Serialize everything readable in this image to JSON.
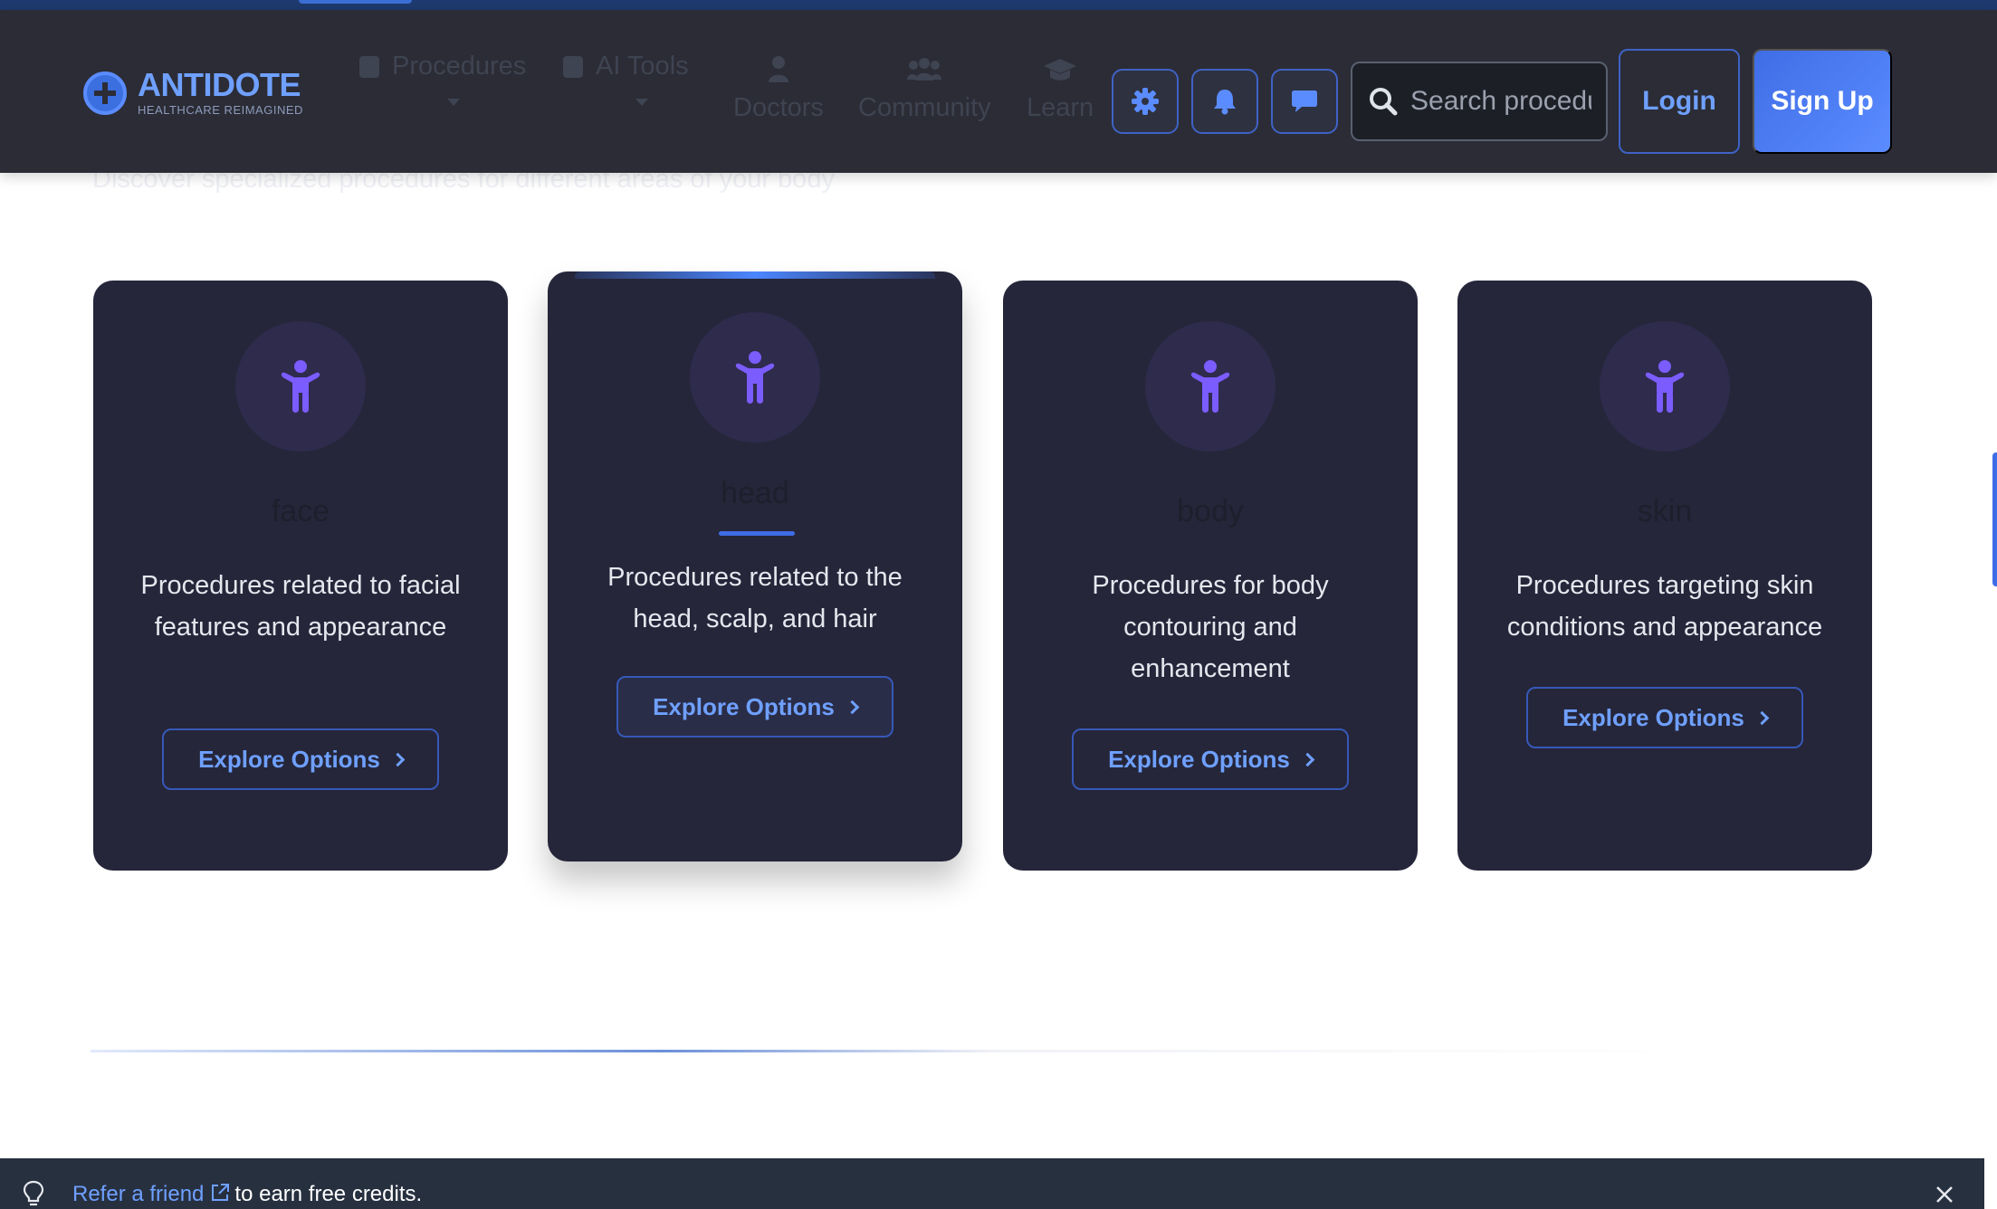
{
  "brand": {
    "name": "ANTIDOTE",
    "tagline": "HEALTHCARE REIMAGINED"
  },
  "nav": {
    "procedures": "Procedures",
    "ai_tools": "AI Tools",
    "doctors": "Doctors",
    "community": "Community",
    "learn": "Learn"
  },
  "search": {
    "placeholder": "Search procedures"
  },
  "auth": {
    "login": "Login",
    "signup": "Sign Up"
  },
  "section": {
    "subtitle": "Discover specialized procedures for different areas of your body"
  },
  "cards": [
    {
      "name": "face",
      "description": "Procedures related to facial features and appearance",
      "button": "Explore Options"
    },
    {
      "name": "head",
      "description": "Procedures related to the head, scalp, and hair",
      "button": "Explore Options"
    },
    {
      "name": "body",
      "description": "Procedures for body contouring and enhancement",
      "button": "Explore Options"
    },
    {
      "name": "skin",
      "description": "Procedures targeting skin conditions and appearance",
      "button": "Explore Options"
    }
  ],
  "banner": {
    "link": "Refer a friend",
    "text": "to earn free credits."
  },
  "colors": {
    "accent": "#3f6de6",
    "link": "#6fa0ff",
    "card_bg": "#25263a",
    "nav_bg": "#2b2c35",
    "icon": "#7b5cff"
  },
  "icons": [
    "settings-icon",
    "bell-icon",
    "chat-icon",
    "search-icon",
    "child-icon",
    "lightbulb-icon",
    "external-link-icon",
    "close-icon"
  ]
}
